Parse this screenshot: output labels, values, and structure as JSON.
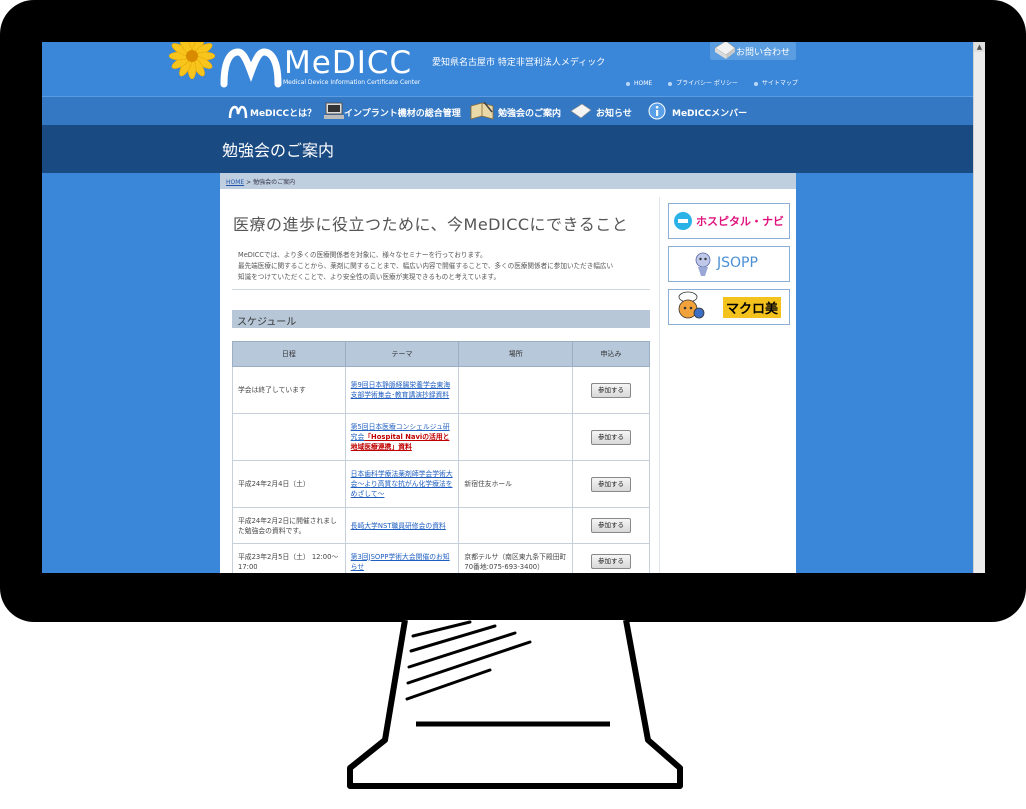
{
  "header": {
    "logo_text": "MeDICC",
    "logo_sub": "Medical Device Information Certificate Center",
    "org_name": "愛知県名古屋市  特定非営利法人メディック",
    "contact_label": "お問い合わせ",
    "toplinks": [
      "HOME",
      "プライバシー ポリシー",
      "サイトマップ"
    ]
  },
  "nav": {
    "items": [
      {
        "label": "MeDICCとは？",
        "icon": "medicc-logo-icon"
      },
      {
        "label": "インプラント機材の総合管理",
        "icon": "computer-icon"
      },
      {
        "label": "勉強会のご案内",
        "icon": "book-icon"
      },
      {
        "label": "お知らせ",
        "icon": "envelope-icon"
      },
      {
        "label": "MeDICCメンバー",
        "icon": "info-icon"
      }
    ]
  },
  "page_title": "勉強会のご案内",
  "breadcrumb": {
    "home": "HOME",
    "sep": ">",
    "current": "勉強会のご案内"
  },
  "heading": "医療の進歩に役立つために、今MeDICCにできること",
  "intro": [
    "MeDICCでは、より多くの医療関係者を対象に、様々なセミナーを行っております。",
    "最先端医療に関することから、薬剤に関することまで、幅広い内容で開催することで、多くの医療関係者に参加いただき幅広い",
    "知識をつけていただくことで、より安全性の高い医療が実現できるものと考えています。"
  ],
  "schedule": {
    "title": "スケジュール",
    "columns": [
      "日程",
      "テーマ",
      "場所",
      "申込み"
    ],
    "button_label": "参加する",
    "rows": [
      {
        "date": "学会は終了しています",
        "theme": "第9回日本静脈経腸栄養学会東海支部学術集会･教育講演抄録資料",
        "theme_red": "",
        "place": ""
      },
      {
        "date": "",
        "theme": "第5回日本医療コンシェルジュ研究会",
        "theme_red": "「Hospital Naviの活用と地域医療連携」資料",
        "place": ""
      },
      {
        "date": "平成24年2月4日（土）",
        "theme": "日本歯科学療法薬剤師学会学術大会～より高質な抗がん化学療法をめざして～",
        "theme_red": "",
        "place": "新宿住友ホール"
      },
      {
        "date": "平成24年2月2日に開催されました勉強会の資料です。",
        "theme": "長崎大学NST職員研修会の資料",
        "theme_red": "",
        "place": ""
      },
      {
        "date": "平成23年2月5日（土） 12:00～17:00",
        "theme": "第3回JSOPP学術大会開催のお知らせ",
        "theme_red": "",
        "place": "京都テルサ（南区東九条下殿田町70番地:075-693-3400）"
      }
    ]
  },
  "sidebar": {
    "banners": [
      {
        "label": "ホスピタル・ナビ",
        "color": "#e0137d"
      },
      {
        "label": "JSOPP",
        "color": "#4a8fd4"
      },
      {
        "label": "マクロ美",
        "color": "#000000"
      }
    ]
  },
  "colors": {
    "screen_bg": "#3a86d8",
    "nav_bg": "#3478c4",
    "title_band": "#1a4a82",
    "table_head": "#b7c8da"
  }
}
